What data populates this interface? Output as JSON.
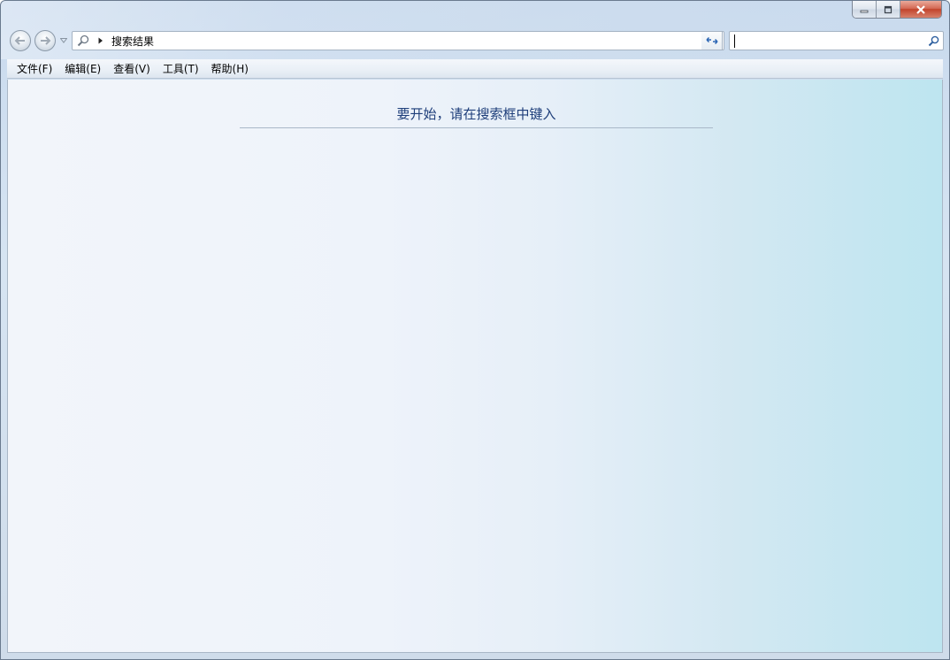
{
  "window": {
    "controls": {
      "minimize": "minimize",
      "maximize": "maximize",
      "close": "close"
    }
  },
  "nav": {
    "address": {
      "crumb": "搜索结果"
    },
    "search": {
      "value": "",
      "placeholder": ""
    }
  },
  "menubar": {
    "items": [
      "文件(F)",
      "编辑(E)",
      "查看(V)",
      "工具(T)",
      "帮助(H)"
    ]
  },
  "content": {
    "prompt": "要开始，请在搜索框中键入"
  },
  "colors": {
    "prompt_text": "#1e3e7a",
    "close_button": "#c2442c",
    "content_right": "#bde5f0"
  },
  "icons": [
    "minimize-icon",
    "maximize-icon",
    "close-icon",
    "back-arrow-icon",
    "forward-arrow-icon",
    "chevron-down-icon",
    "search-icon",
    "breadcrumb-arrow-icon",
    "refresh-icon"
  ]
}
